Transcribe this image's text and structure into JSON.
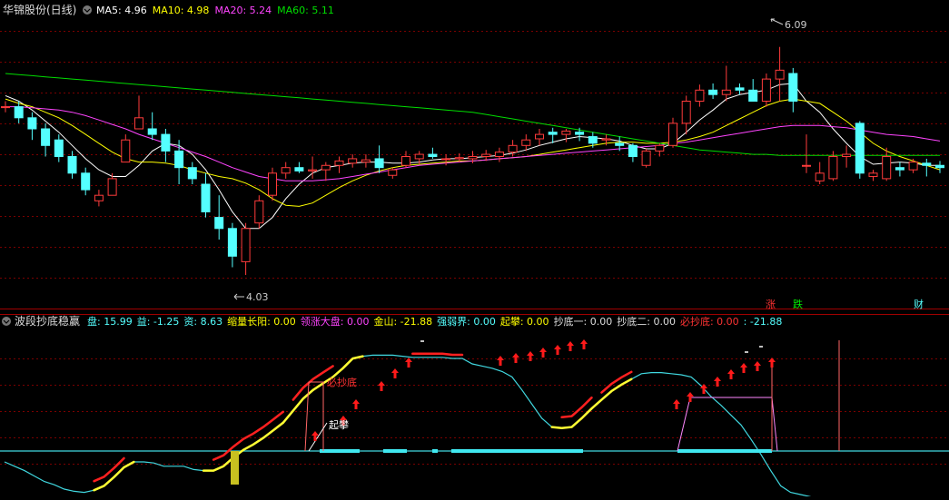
{
  "main_panel": {
    "title": "华锦股份(日线)",
    "ma_items": [
      {
        "label": "MA5: 4.96",
        "color": "#ffffff"
      },
      {
        "label": "MA10: 4.98",
        "color": "#ffff00"
      },
      {
        "label": "MA20: 5.24",
        "color": "#ff44ff"
      },
      {
        "label": "MA60: 5.11",
        "color": "#00dd00"
      }
    ],
    "annotations": {
      "high": "6.09",
      "low": "4.03"
    },
    "markers": [
      {
        "text": "涨",
        "color": "#ff3333"
      },
      {
        "text": "跌",
        "color": "#00ee00"
      },
      {
        "text": "财",
        "color": "#55ffff"
      }
    ]
  },
  "indicator_panel": {
    "title": "波段抄底稳赢",
    "items": [
      {
        "label": "盘: 15.99",
        "color": "#55ffff"
      },
      {
        "label": "益: -1.25",
        "color": "#55ffff"
      },
      {
        "label": "资: 8.63",
        "color": "#55ffff"
      },
      {
        "label": "缩量长阳: 0.00",
        "color": "#ffff00"
      },
      {
        "label": "领涨大盘: 0.00",
        "color": "#ff44ff"
      },
      {
        "label": "金山: -21.88",
        "color": "#ffff00"
      },
      {
        "label": "强弱界: 0.00",
        "color": "#55ffff"
      },
      {
        "label": "起攀: 0.00",
        "color": "#ffff00"
      },
      {
        "label": "抄底一: 0.00",
        "color": "#dddddd"
      },
      {
        "label": "抄底二: 0.00",
        "color": "#dddddd"
      },
      {
        "label": "必抄底: 0.00",
        "color": "#ff3333"
      },
      {
        "label": ": -21.88",
        "color": "#55ffff"
      }
    ],
    "labels": {
      "bichaodi": "必抄底",
      "qipan": "起攀"
    }
  },
  "chart_data": {
    "type": "candlestick",
    "title": "华锦股份(日线)",
    "ylim": [
      3.85,
      6.35
    ],
    "grid": true,
    "candles": [
      [
        5.55,
        5.6,
        5.5,
        5.55
      ],
      [
        5.55,
        5.6,
        5.4,
        5.45
      ],
      [
        5.45,
        5.5,
        5.25,
        5.35
      ],
      [
        5.35,
        5.4,
        5.1,
        5.2
      ],
      [
        5.25,
        5.3,
        5.05,
        5.1
      ],
      [
        5.1,
        5.15,
        4.9,
        4.95
      ],
      [
        4.95,
        5.0,
        4.75,
        4.8
      ],
      [
        4.7,
        4.8,
        4.65,
        4.75
      ],
      [
        4.75,
        4.95,
        4.75,
        4.9
      ],
      [
        5.05,
        5.3,
        5.05,
        5.25
      ],
      [
        5.35,
        5.65,
        5.35,
        5.45
      ],
      [
        5.35,
        5.5,
        5.25,
        5.3
      ],
      [
        5.3,
        5.35,
        5.05,
        5.15
      ],
      [
        5.15,
        5.25,
        4.85,
        5.0
      ],
      [
        5.0,
        5.05,
        4.85,
        4.9
      ],
      [
        4.85,
        4.95,
        4.55,
        4.6
      ],
      [
        4.55,
        4.75,
        4.35,
        4.45
      ],
      [
        4.45,
        4.5,
        4.1,
        4.2
      ],
      [
        4.15,
        4.5,
        4.03,
        4.45
      ],
      [
        4.5,
        4.75,
        4.45,
        4.7
      ],
      [
        4.75,
        5.0,
        4.7,
        4.95
      ],
      [
        4.95,
        5.05,
        4.9,
        5.0
      ],
      [
        5.0,
        5.05,
        4.95,
        4.97
      ],
      [
        4.97,
        5.1,
        4.9,
        4.98
      ],
      [
        4.98,
        5.05,
        4.88,
        5.02
      ],
      [
        5.02,
        5.1,
        4.95,
        5.06
      ],
      [
        5.04,
        5.12,
        5.0,
        5.08
      ],
      [
        5.05,
        5.12,
        5.0,
        5.07
      ],
      [
        5.08,
        5.2,
        4.95,
        5.0
      ],
      [
        4.93,
        5.0,
        4.9,
        4.98
      ],
      [
        5.02,
        5.15,
        5.0,
        5.1
      ],
      [
        5.08,
        5.15,
        5.03,
        5.12
      ],
      [
        5.12,
        5.18,
        5.08,
        5.1
      ],
      [
        5.08,
        5.12,
        5.02,
        5.08
      ],
      [
        5.08,
        5.13,
        5.05,
        5.09
      ],
      [
        5.08,
        5.15,
        5.04,
        5.1
      ],
      [
        5.1,
        5.16,
        5.06,
        5.12
      ],
      [
        5.1,
        5.18,
        5.05,
        5.14
      ],
      [
        5.14,
        5.25,
        5.1,
        5.2
      ],
      [
        5.2,
        5.3,
        5.15,
        5.25
      ],
      [
        5.26,
        5.35,
        5.2,
        5.3
      ],
      [
        5.32,
        5.36,
        5.22,
        5.3
      ],
      [
        5.3,
        5.35,
        5.23,
        5.33
      ],
      [
        5.32,
        5.36,
        5.24,
        5.3
      ],
      [
        5.28,
        5.32,
        5.18,
        5.22
      ],
      [
        5.25,
        5.3,
        5.2,
        5.26
      ],
      [
        5.22,
        5.28,
        5.15,
        5.2
      ],
      [
        5.2,
        5.22,
        5.05,
        5.1
      ],
      [
        5.02,
        5.17,
        5.0,
        5.15
      ],
      [
        5.15,
        5.22,
        5.1,
        5.2
      ],
      [
        5.2,
        5.45,
        5.18,
        5.4
      ],
      [
        5.4,
        5.65,
        5.3,
        5.6
      ],
      [
        5.6,
        5.75,
        5.55,
        5.7
      ],
      [
        5.7,
        5.76,
        5.62,
        5.66
      ],
      [
        5.66,
        5.92,
        5.6,
        5.7
      ],
      [
        5.72,
        5.76,
        5.66,
        5.7
      ],
      [
        5.7,
        5.8,
        5.62,
        5.6
      ],
      [
        5.6,
        5.85,
        5.55,
        5.8
      ],
      [
        5.8,
        6.09,
        5.6,
        5.88
      ],
      [
        5.85,
        5.9,
        5.5,
        5.6
      ],
      [
        5.02,
        5.3,
        4.95,
        5.02
      ],
      [
        4.88,
        5.05,
        4.85,
        4.95
      ],
      [
        4.9,
        5.15,
        4.88,
        5.1
      ],
      [
        5.1,
        5.2,
        5.0,
        5.12
      ],
      [
        5.4,
        5.42,
        4.9,
        4.95
      ],
      [
        4.92,
        4.98,
        4.88,
        4.95
      ],
      [
        4.9,
        5.18,
        4.88,
        5.1
      ],
      [
        5.0,
        5.05,
        4.92,
        4.98
      ],
      [
        4.98,
        5.08,
        4.95,
        5.05
      ],
      [
        5.04,
        5.08,
        4.92,
        5.02
      ],
      [
        5.02,
        5.06,
        4.95,
        5.0
      ]
    ],
    "ma_lines": [
      {
        "name": "MA5",
        "color": "#ffffff",
        "values": [
          5.65,
          5.6,
          5.52,
          5.42,
          5.32,
          5.2,
          5.08,
          4.98,
          4.92,
          4.92,
          5.02,
          5.15,
          5.22,
          5.2,
          5.12,
          4.98,
          4.8,
          4.6,
          4.45,
          4.45,
          4.55,
          4.72,
          4.85,
          4.95,
          5.0,
          5.02,
          5.04,
          5.05,
          5.05,
          5.04,
          5.04,
          5.05,
          5.07,
          5.08,
          5.08,
          5.09,
          5.1,
          5.11,
          5.13,
          5.16,
          5.2,
          5.23,
          5.26,
          5.28,
          5.27,
          5.26,
          5.24,
          5.2,
          5.17,
          5.17,
          5.22,
          5.32,
          5.43,
          5.52,
          5.62,
          5.66,
          5.68,
          5.7,
          5.75,
          5.76,
          5.6,
          5.5,
          5.35,
          5.22,
          5.1,
          5.03,
          5.04,
          5.05,
          5.04,
          5.02,
          5.02
        ]
      },
      {
        "name": "MA10",
        "color": "#ffff00",
        "values": [
          5.62,
          5.58,
          5.55,
          5.5,
          5.45,
          5.38,
          5.3,
          5.22,
          5.14,
          5.08,
          5.05,
          5.05,
          5.04,
          5.02,
          4.98,
          4.95,
          4.92,
          4.9,
          4.86,
          4.8,
          4.72,
          4.66,
          4.65,
          4.68,
          4.75,
          4.82,
          4.88,
          4.93,
          4.97,
          5.0,
          5.02,
          5.03,
          5.04,
          5.05,
          5.06,
          5.06,
          5.07,
          5.08,
          5.09,
          5.1,
          5.12,
          5.14,
          5.16,
          5.18,
          5.2,
          5.22,
          5.23,
          5.23,
          5.22,
          5.22,
          5.23,
          5.25,
          5.28,
          5.32,
          5.38,
          5.44,
          5.5,
          5.56,
          5.6,
          5.62,
          5.6,
          5.58,
          5.5,
          5.42,
          5.32,
          5.22,
          5.15,
          5.1,
          5.06,
          5.02,
          4.98
        ]
      },
      {
        "name": "MA20",
        "color": "#ff44ff",
        "values": [
          5.55,
          5.55,
          5.54,
          5.53,
          5.52,
          5.5,
          5.47,
          5.43,
          5.39,
          5.35,
          5.3,
          5.26,
          5.22,
          5.18,
          5.14,
          5.1,
          5.05,
          5.0,
          4.96,
          4.92,
          4.9,
          4.88,
          4.88,
          4.88,
          4.89,
          4.9,
          4.92,
          4.94,
          4.96,
          4.98,
          5.0,
          5.02,
          5.03,
          5.04,
          5.05,
          5.06,
          5.07,
          5.08,
          5.09,
          5.1,
          5.11,
          5.12,
          5.13,
          5.14,
          5.15,
          5.16,
          5.17,
          5.18,
          5.19,
          5.2,
          5.22,
          5.23,
          5.25,
          5.27,
          5.29,
          5.31,
          5.33,
          5.35,
          5.37,
          5.38,
          5.38,
          5.38,
          5.37,
          5.36,
          5.34,
          5.32,
          5.3,
          5.29,
          5.28,
          5.26,
          5.24
        ]
      },
      {
        "name": "MA60",
        "color": "#00dd00",
        "values": [
          5.85,
          5.84,
          5.83,
          5.82,
          5.81,
          5.8,
          5.79,
          5.78,
          5.77,
          5.76,
          5.75,
          5.74,
          5.73,
          5.72,
          5.71,
          5.7,
          5.69,
          5.68,
          5.67,
          5.66,
          5.65,
          5.64,
          5.63,
          5.62,
          5.61,
          5.6,
          5.59,
          5.58,
          5.57,
          5.56,
          5.55,
          5.54,
          5.53,
          5.52,
          5.51,
          5.5,
          5.48,
          5.46,
          5.44,
          5.42,
          5.4,
          5.38,
          5.36,
          5.34,
          5.32,
          5.3,
          5.28,
          5.26,
          5.24,
          5.22,
          5.2,
          5.18,
          5.16,
          5.15,
          5.14,
          5.13,
          5.12,
          5.12,
          5.11,
          5.11,
          5.11,
          5.11,
          5.11,
          5.11,
          5.11,
          5.11,
          5.11,
          5.11,
          5.11,
          5.11,
          5.11
        ]
      }
    ],
    "indicator": {
      "ylim": [
        -40,
        110
      ],
      "zero": 0,
      "curve": [
        -10,
        -14,
        -18,
        -23,
        -28,
        -31,
        -35,
        -37,
        -38,
        -36,
        -32,
        -24,
        -15,
        -10,
        -10,
        -11,
        -14,
        -14,
        -14,
        -17,
        -18,
        -18,
        -14,
        -6,
        1,
        6,
        12,
        19,
        26,
        37,
        48,
        56,
        62,
        68,
        76,
        85,
        87,
        88,
        88,
        88,
        87,
        86,
        86,
        86,
        86,
        85,
        85,
        80,
        78,
        76,
        73,
        68,
        56,
        43,
        30,
        22,
        21,
        22,
        30,
        39,
        47,
        55,
        61,
        66,
        71,
        72,
        72,
        71,
        70,
        68,
        60,
        50,
        42,
        33,
        24,
        11,
        -3,
        -18,
        -32,
        -38,
        -40,
        -42,
        -45,
        -47,
        -49,
        -51,
        -52,
        -53,
        -54,
        -55,
        -56,
        -57,
        -58,
        -59,
        -60
      ],
      "events": "cyan bars, red arrows, histogram, buy marks"
    }
  }
}
